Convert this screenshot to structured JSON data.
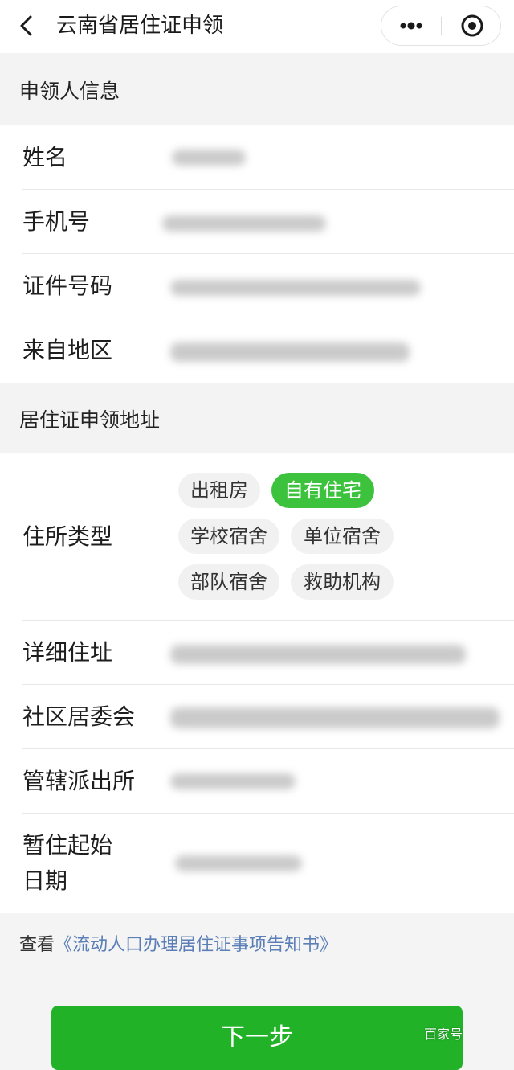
{
  "nav": {
    "title": "云南省居住证申领"
  },
  "applicant_section": {
    "title": "申领人信息",
    "fields": [
      {
        "label": "姓名"
      },
      {
        "label": "手机号"
      },
      {
        "label": "证件号码"
      },
      {
        "label": "来自地区"
      }
    ]
  },
  "address_section": {
    "title": "居住证申领地址",
    "residence_type": {
      "label": "住所类型",
      "options": [
        "出租房",
        "自有住宅",
        "学校宿舍",
        "单位宿舍",
        "部队宿舍",
        "救助机构"
      ],
      "selected": "自有住宅"
    },
    "fields": [
      {
        "label": "详细住址"
      },
      {
        "label": "社区居委会"
      },
      {
        "label": "管辖派出所"
      },
      {
        "label_line1": "暂住起始",
        "label_line2": "日期"
      }
    ]
  },
  "notice": {
    "prefix": "查看",
    "link": "《流动人口办理居住证事项告知书》"
  },
  "next_button": {
    "label": "下一步"
  },
  "watermark": "百家号",
  "colors": {
    "accent": "#3cc23c",
    "button": "#21b227",
    "link": "#5b7fb6"
  }
}
